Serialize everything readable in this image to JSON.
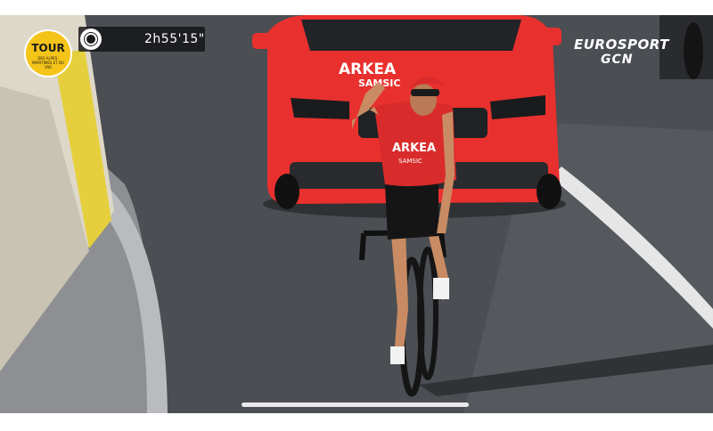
{
  "race_logo": {
    "title": "TOUR",
    "subtitle": "DES ALPES-MARITIMES ET DU VAR"
  },
  "timer": {
    "elapsed": "2h55'15\"",
    "icon": "stopwatch-icon"
  },
  "broadcaster": {
    "primary": "EUROSPORT",
    "secondary": "GCN"
  },
  "car": {
    "hood_text": "ARKEA",
    "hood_subtext": "SAMSIC",
    "color": "#e8312e"
  },
  "rider": {
    "jersey_text": "ARKEA",
    "jersey_subtext": "SAMSIC",
    "jersey_color": "#d92b2b"
  },
  "colors": {
    "road": "#4a4d52",
    "barrier": "#ded8c8",
    "logo_yellow": "#f5c419"
  }
}
